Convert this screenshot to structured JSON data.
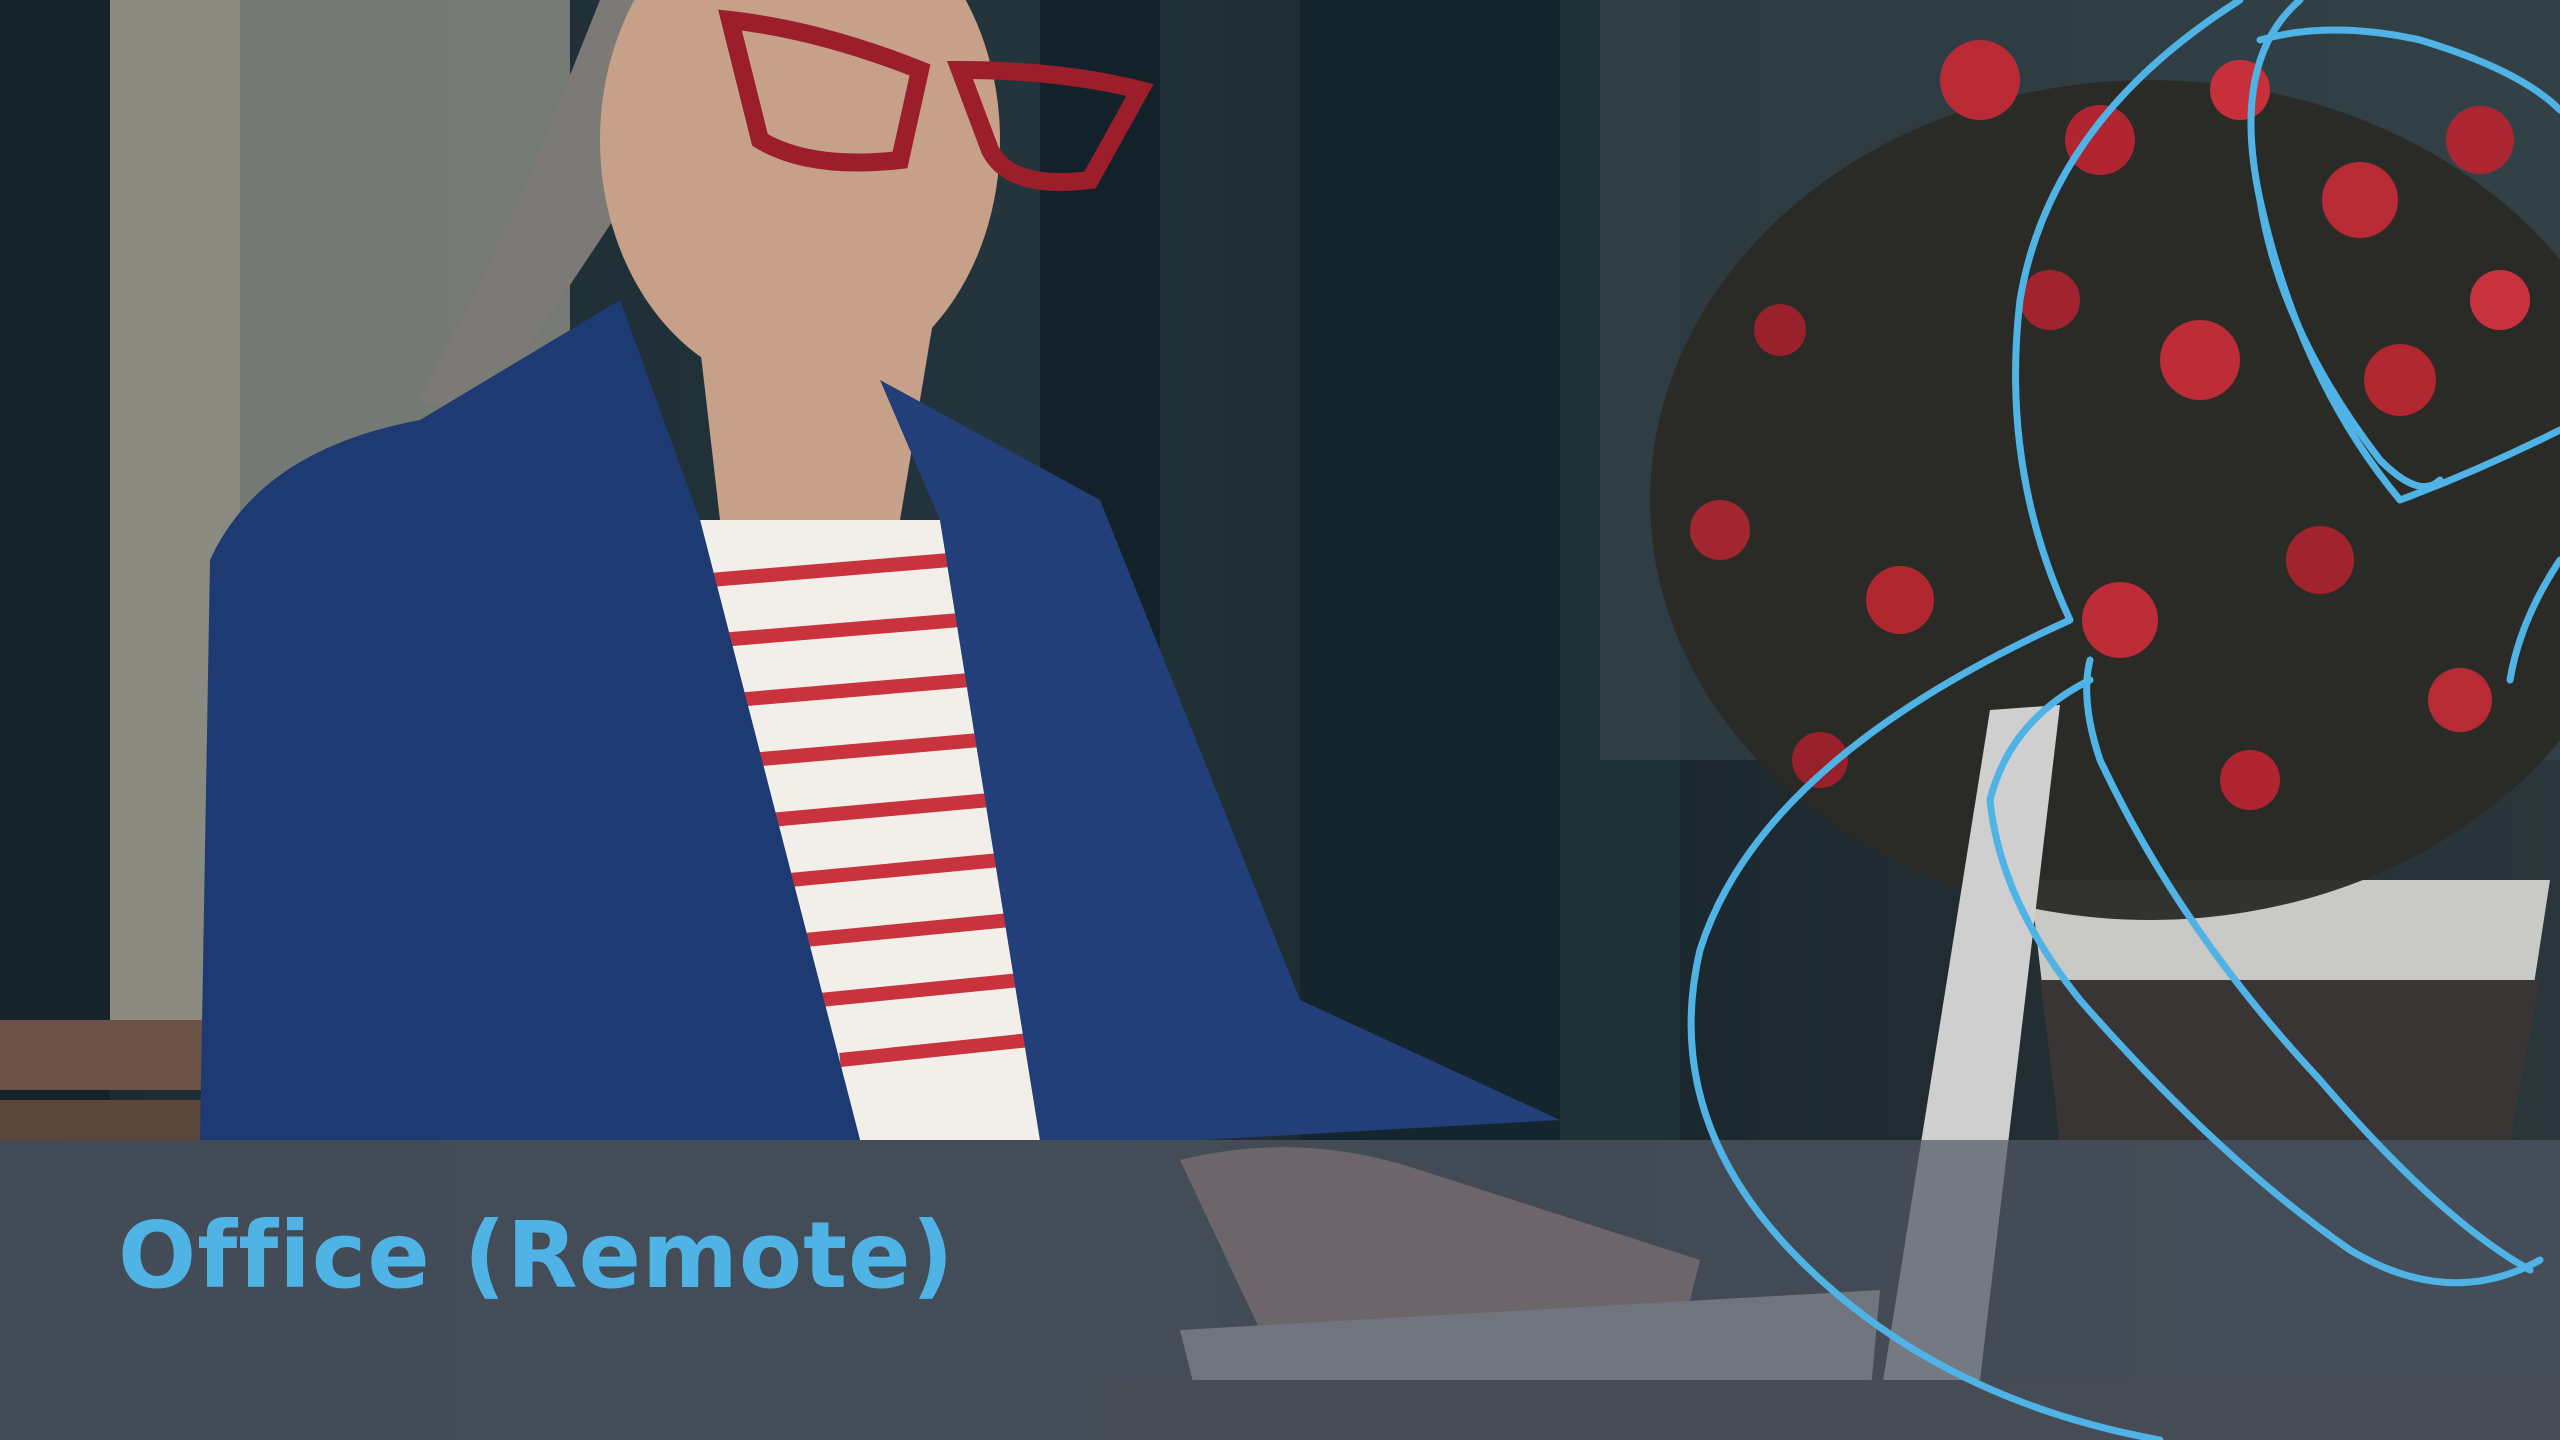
{
  "caption": {
    "title": "Office (Remote)"
  },
  "photo": {
    "subject": "woman-working-on-laptop-icon",
    "decoration": "ampersand-outline-icon"
  },
  "colors": {
    "accent": "#4fb3e6",
    "band": "#505864"
  }
}
